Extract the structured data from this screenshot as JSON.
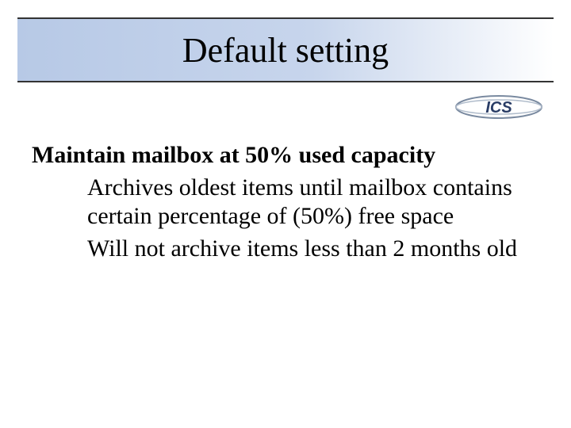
{
  "title": "Default setting",
  "logo_text": "ICS",
  "heading": "Maintain mailbox at 50% used capacity",
  "points": [
    "Archives oldest items until mailbox contains certain percentage of (50%) free space",
    "Will not archive items less than 2 months old"
  ]
}
